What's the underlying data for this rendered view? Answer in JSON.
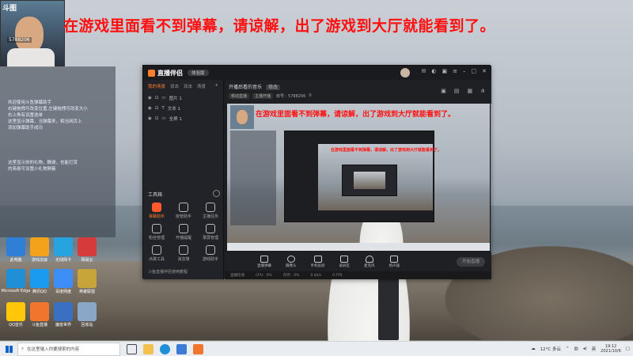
{
  "banner_text": "在游戏里面看不到弹幕，请谅解，出了游戏到大厅就能看到了。",
  "webcam": {
    "logo": "斗图",
    "id": "5788206"
  },
  "chat_overlay": [
    "欢迎使用斗鱼弹幕助手",
    "右键拖拽可改变位置,左键拖拽可改变大小",
    "右上角有设置选单",
    "这里显示弹幕，当弹幕来，相当网页上",
    "添加弹幕助手成功",
    "这里显示你的礼物，酬谢，也能打赏",
    "的简易可设置小礼物屏蔽"
  ],
  "desktop_icons": [
    {
      "label": "此电脑",
      "color": "#2f7fd6"
    },
    {
      "label": "游戏加速",
      "color": "#f3a21c"
    },
    {
      "label": "无线网卡",
      "color": "#27a3e0"
    },
    {
      "label": "网易云",
      "color": "#d63b3b"
    },
    {
      "label": "Microsoft Edge",
      "color": "#1f8fd8"
    },
    {
      "label": "腾讯QQ",
      "color": "#1b9bf0"
    },
    {
      "label": "百度网盘",
      "color": "#3e8ef7"
    },
    {
      "label": "英雄联盟",
      "color": "#c8a53a"
    },
    {
      "label": "QQ音乐",
      "color": "#ffc60a"
    },
    {
      "label": "斗鱼直播",
      "color": "#f0762d"
    },
    {
      "label": "魔兽世界",
      "color": "#3a6fc1"
    },
    {
      "label": "回收站",
      "color": "#8aa7c8"
    }
  ],
  "app": {
    "title": "直播伴侣",
    "badge": "体验版",
    "scene_tabs": [
      "我的场景",
      "双击",
      "双击",
      "场景"
    ],
    "layers": [
      {
        "label": "图片 1"
      },
      {
        "label": "文本 1"
      },
      {
        "label": "全屏 1"
      }
    ],
    "tools_title": "工具箱",
    "tools": [
      {
        "label": "弹幕助手",
        "hot": true
      },
      {
        "label": "房管助手",
        "hot": false
      },
      {
        "label": "主播任务",
        "hot": false
      },
      {
        "label": "粉丝管理",
        "hot": false
      },
      {
        "label": "开播提醒",
        "hot": false
      },
      {
        "label": "录屏管理",
        "hot": false
      },
      {
        "label": "点歌工具",
        "hot": false
      },
      {
        "label": "消息墙",
        "hot": false
      },
      {
        "label": "游戏助手",
        "hot": false
      }
    ],
    "sidebar_foot": "斗鱼直播伴侣使用教程",
    "room_title": "开播后看的音乐",
    "room_tag": "修改",
    "room_line": [
      "移动直播",
      "主播开播",
      "房号：5788206",
      "0"
    ],
    "controls": [
      "直播弹幕",
      "摄像头",
      "手机投屏",
      "录屏区",
      "麦克风",
      "扬声器"
    ],
    "start_label": "开始直播",
    "status": [
      "直播检测",
      "CPU：0%",
      "内存：0%",
      "0 kb/s",
      "0 FPS"
    ]
  },
  "taskbar": {
    "search_placeholder": "在这里输入你要搜索的内容",
    "weather": "12°C 多云",
    "time": "19:12",
    "date": "2021/10/6",
    "ime": "英"
  }
}
